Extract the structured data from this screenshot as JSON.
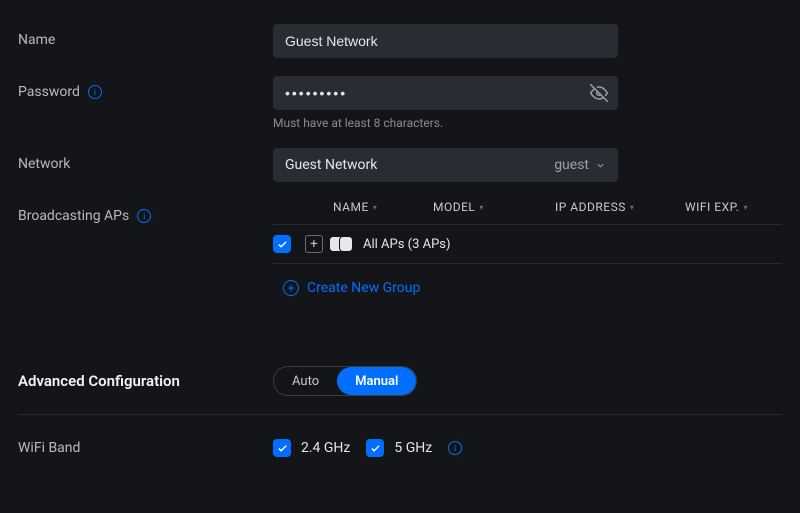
{
  "fields": {
    "name": {
      "label": "Name",
      "value": "Guest Network"
    },
    "password": {
      "label": "Password",
      "value": "•••••••••",
      "helper": "Must have at least 8 characters."
    },
    "network": {
      "label": "Network",
      "value": "Guest Network",
      "tag": "guest"
    },
    "broadcasting": {
      "label": "Broadcasting APs"
    }
  },
  "ap_table": {
    "columns": [
      "NAME",
      "MODEL",
      "IP ADDRESS",
      "WIFI EXP."
    ],
    "row_label": "All APs (3 APs)",
    "create_label": "Create New Group"
  },
  "advanced": {
    "title": "Advanced Configuration",
    "auto": "Auto",
    "manual": "Manual"
  },
  "wifi_band": {
    "label": "WiFi Band",
    "opt1": "2.4 GHz",
    "opt2": "5 GHz"
  }
}
